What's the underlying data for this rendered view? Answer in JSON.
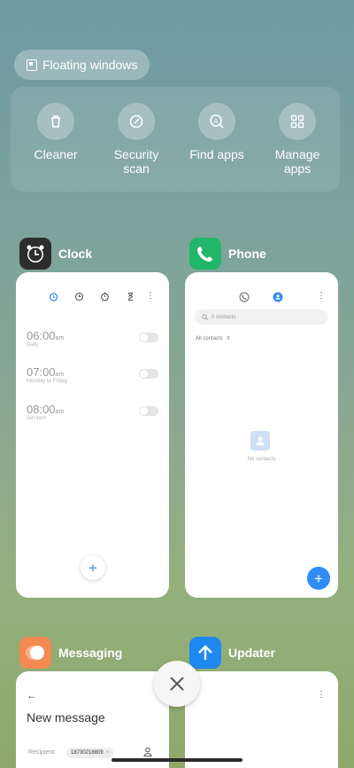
{
  "top": {
    "floating_windows": "Floating windows"
  },
  "tools": [
    {
      "label1": "Cleaner",
      "label2": "",
      "icon": "trash-icon"
    },
    {
      "label1": "Security",
      "label2": "scan",
      "icon": "shield-check-icon"
    },
    {
      "label1": "Find apps",
      "label2": "",
      "icon": "find-apps-icon"
    },
    {
      "label1": "Manage",
      "label2": "apps",
      "icon": "grid-icon"
    }
  ],
  "clock": {
    "name": "Clock",
    "alarms": [
      {
        "time": "06:00",
        "ampm": "am",
        "desc": "Daily"
      },
      {
        "time": "07:00",
        "ampm": "am",
        "desc": "Monday to Friday"
      },
      {
        "time": "08:00",
        "ampm": "am",
        "desc": "Set item"
      }
    ]
  },
  "phone": {
    "name": "Phone",
    "search_placeholder": "0 contacts",
    "filter": "All contacts",
    "empty": "No contacts"
  },
  "messaging": {
    "name": "Messaging",
    "title": "New message",
    "recipient_label": "Recipient:",
    "recipient_chip": "18730218809"
  },
  "updater": {
    "name": "Updater"
  },
  "colors": {
    "accent_blue": "#2f8cf6",
    "phone_green": "#22b66a",
    "messaging_orange": "#f28a52",
    "updater_blue": "#1e88f0"
  }
}
